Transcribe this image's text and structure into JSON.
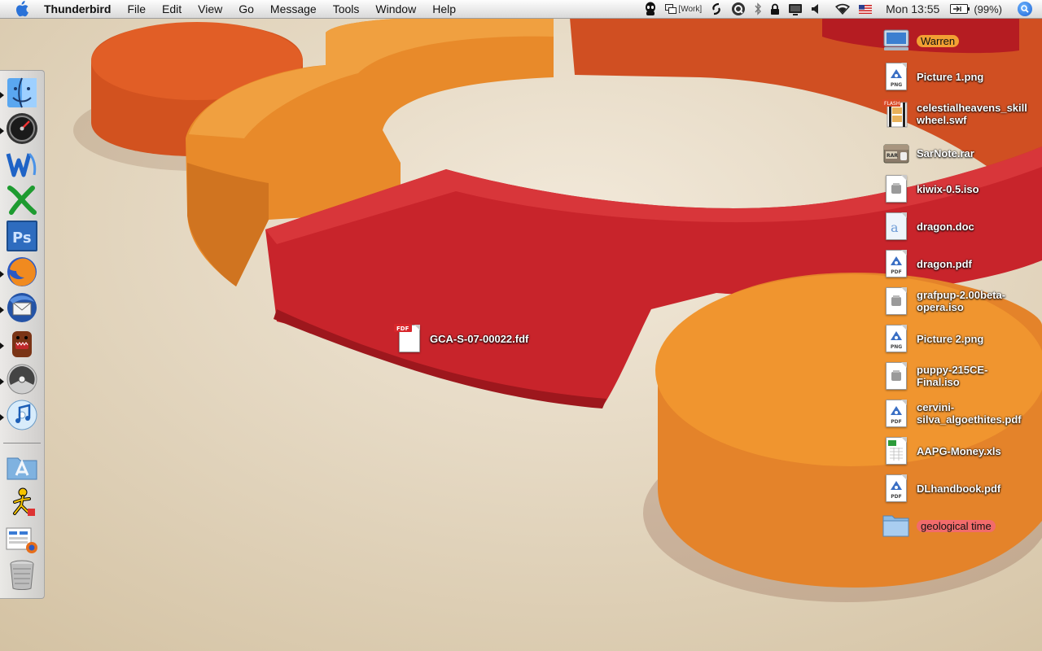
{
  "menubar": {
    "app_name": "Thunderbird",
    "menus": [
      "File",
      "Edit",
      "View",
      "Go",
      "Message",
      "Tools",
      "Window",
      "Help"
    ],
    "workspace": "[Work]",
    "clock": "Mon 13:55",
    "battery": "(99%)"
  },
  "dock": {
    "items": [
      {
        "name": "finder-icon",
        "running": true
      },
      {
        "name": "dashboard-icon",
        "running": true
      },
      {
        "name": "word-icon",
        "running": false
      },
      {
        "name": "excel-icon",
        "running": false
      },
      {
        "name": "photoshop-icon",
        "running": false
      },
      {
        "name": "firefox-icon",
        "running": true
      },
      {
        "name": "thunderbird-icon",
        "running": true
      },
      {
        "name": "domo-icon",
        "running": true
      },
      {
        "name": "burn-icon",
        "running": true
      },
      {
        "name": "itunes-icon",
        "running": true
      },
      {
        "name": "applications-folder-icon",
        "running": false
      },
      {
        "name": "aim-icon",
        "running": false
      },
      {
        "name": "downloads-stack-icon",
        "running": false
      },
      {
        "name": "trash-icon",
        "running": false
      }
    ]
  },
  "desktop": {
    "floating_file": {
      "label": "GCA-S-07-00022.fdf",
      "type": "FDF"
    },
    "icons": [
      {
        "label": "Warren",
        "kind": "drive",
        "tag": "orange"
      },
      {
        "label": "Picture 1.png",
        "kind": "doc",
        "type": "PNG"
      },
      {
        "label": "celestialheavens_skillwheel.swf",
        "kind": "flash",
        "type": "FLASH"
      },
      {
        "label": "SarNote.rar",
        "kind": "rar",
        "type": "RAR"
      },
      {
        "label": "kiwix-0.5.iso",
        "kind": "iso"
      },
      {
        "label": "dragon.doc",
        "kind": "word"
      },
      {
        "label": "dragon.pdf",
        "kind": "doc",
        "type": "PDF"
      },
      {
        "label": "grafpup-2.00beta-opera.iso",
        "kind": "iso"
      },
      {
        "label": "Picture 2.png",
        "kind": "doc",
        "type": "PNG"
      },
      {
        "label": "puppy-215CE-Final.iso",
        "kind": "iso"
      },
      {
        "label": "cervini-silva_algoethites.pdf",
        "kind": "doc",
        "type": "PDF"
      },
      {
        "label": "AAPG-Money.xls",
        "kind": "xls"
      },
      {
        "label": "DLhandbook.pdf",
        "kind": "doc",
        "type": "PDF"
      },
      {
        "label": "geological time",
        "kind": "folder",
        "tag": "red"
      }
    ]
  },
  "colors": {
    "orange": "#e8872a",
    "red": "#c62127",
    "menubar": "#e9e9e9"
  }
}
